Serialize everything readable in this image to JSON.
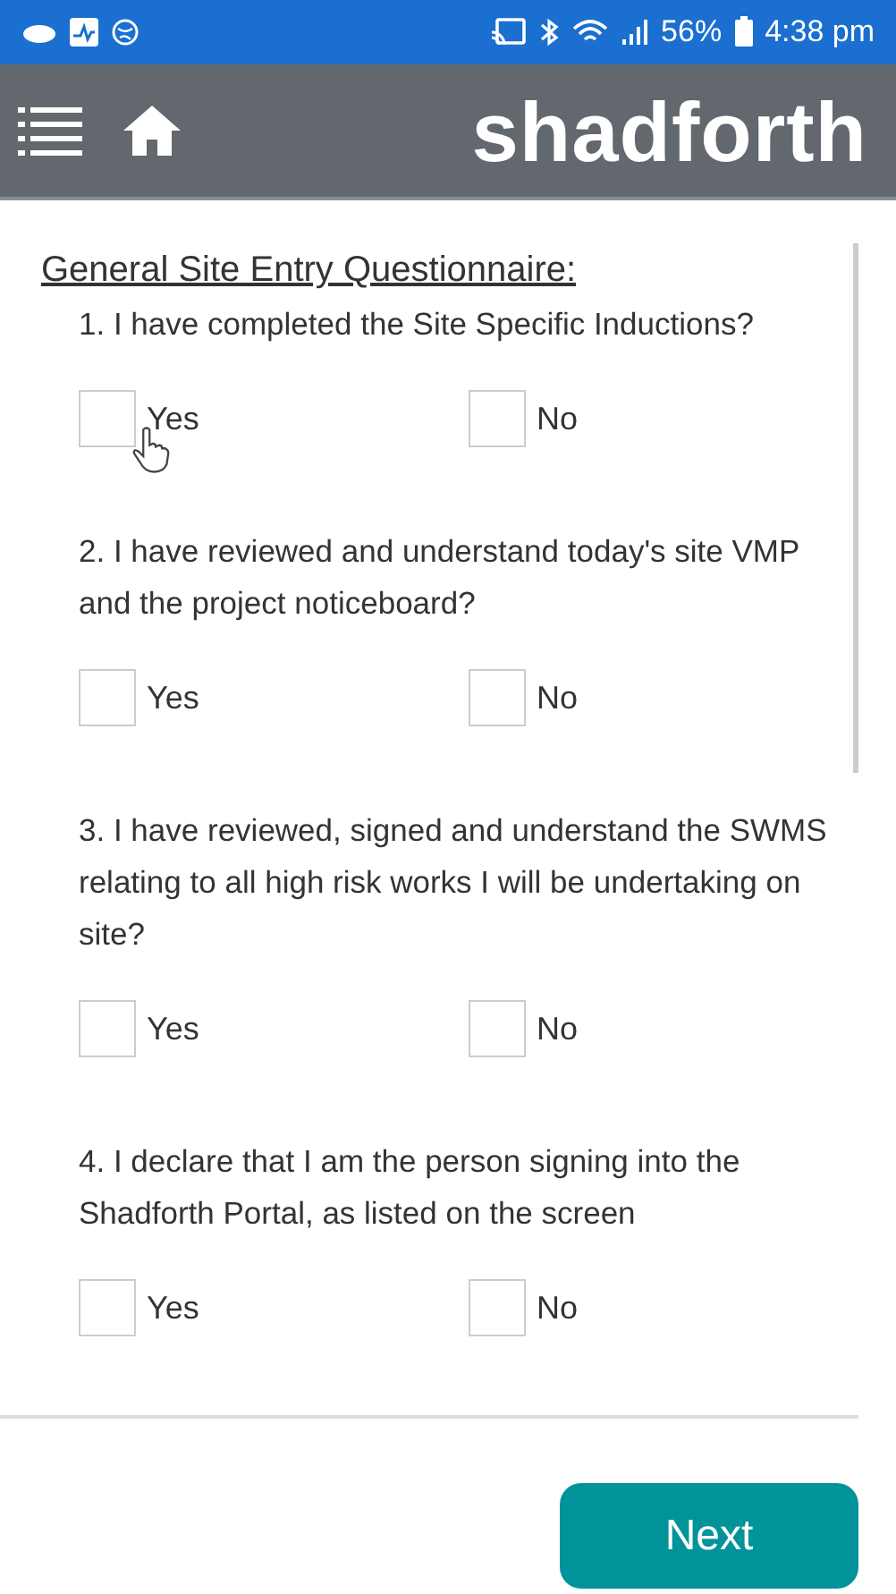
{
  "status_bar": {
    "battery": "56%",
    "time": "4:38 pm"
  },
  "header": {
    "logo": "shadforth"
  },
  "form": {
    "title": "General Site Entry Questionnaire:",
    "questions": [
      {
        "text": "1. I have completed the Site Specific Inductions?",
        "options": [
          {
            "label": "Yes",
            "checked": false
          },
          {
            "label": "No",
            "checked": false
          }
        ]
      },
      {
        "text": "2. I have reviewed and understand today's site VMP and the project noticeboard?",
        "options": [
          {
            "label": "Yes",
            "checked": false
          },
          {
            "label": "No",
            "checked": false
          }
        ]
      },
      {
        "text": "3. I have reviewed, signed and understand the SWMS relating to all high risk works I will be undertaking on site?",
        "options": [
          {
            "label": "Yes",
            "checked": false
          },
          {
            "label": "No",
            "checked": false
          }
        ]
      },
      {
        "text": "4. I declare that I am the person signing into the Shadforth Portal, as listed on the screen",
        "options": [
          {
            "label": "Yes",
            "checked": false
          },
          {
            "label": "No",
            "checked": false
          }
        ]
      }
    ]
  },
  "next_button": "Next"
}
